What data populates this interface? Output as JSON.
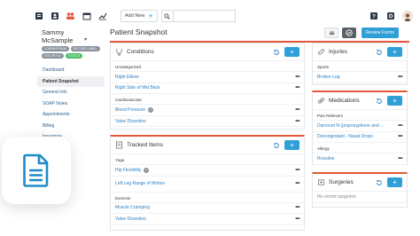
{
  "topbar": {
    "add_new_label": "Add New",
    "icons": [
      "home-icon",
      "contacts-icon",
      "group-icon",
      "calendar-icon",
      "chart-icon",
      "search-icon",
      "help-icon",
      "settings-icon"
    ]
  },
  "patient": {
    "name": "Sammy McSample",
    "chips": [
      "LOREM IPSUM",
      "RECORD LABEL",
      "DOLOR SIT",
      "STATUS"
    ]
  },
  "sidebar": {
    "items": [
      {
        "label": "Dashboard"
      },
      {
        "label": "Patient Snapshot"
      },
      {
        "label": "General Info"
      },
      {
        "label": "SOAP Notes"
      },
      {
        "label": "Appointments"
      },
      {
        "label": "Billing"
      },
      {
        "label": "Insurance"
      }
    ]
  },
  "header": {
    "title": "Patient Snapshot",
    "review_forms_label": "Review Forms"
  },
  "conditions": {
    "title": "Conditions",
    "groups": [
      {
        "label": "Uncategorized",
        "rows": [
          {
            "text": "Right Elbow"
          },
          {
            "text": "Right Side of Mid Back"
          }
        ]
      },
      {
        "label": "Cardiovascular",
        "rows": [
          {
            "text": "Blood Pressure",
            "check": true
          },
          {
            "text": "Valve Disorders"
          }
        ]
      }
    ]
  },
  "tracked_items": {
    "title": "Tracked Items",
    "groups": [
      {
        "label": "Yoga",
        "rows": [
          {
            "text": "Hip Flexibility",
            "check": true
          },
          {
            "text": "Left Leg Range of Motion"
          }
        ]
      },
      {
        "label": "Exercise",
        "rows": [
          {
            "text": "Muscle Cramping"
          },
          {
            "text": "Valve Disorders"
          }
        ]
      }
    ]
  },
  "injuries": {
    "title": "Injuries",
    "groups": [
      {
        "label": "Sports",
        "rows": [
          {
            "text": "Broken Leg"
          }
        ]
      }
    ]
  },
  "medications": {
    "title": "Medications",
    "groups": [
      {
        "label": "Pain Relievers",
        "rows": [
          {
            "text": "Darvocet N (propoxyphene and ..."
          },
          {
            "text": "Decongestant - Nasal Drops"
          }
        ]
      },
      {
        "label": "Allergy",
        "rows": [
          {
            "text": "Rosuline"
          }
        ]
      }
    ]
  },
  "surgeries": {
    "title": "Surgeries",
    "empty_text": "No recent surgeries"
  },
  "colors": {
    "accent": "#e5583a",
    "primary": "#2f9fd8",
    "link": "#2d7fc1"
  }
}
